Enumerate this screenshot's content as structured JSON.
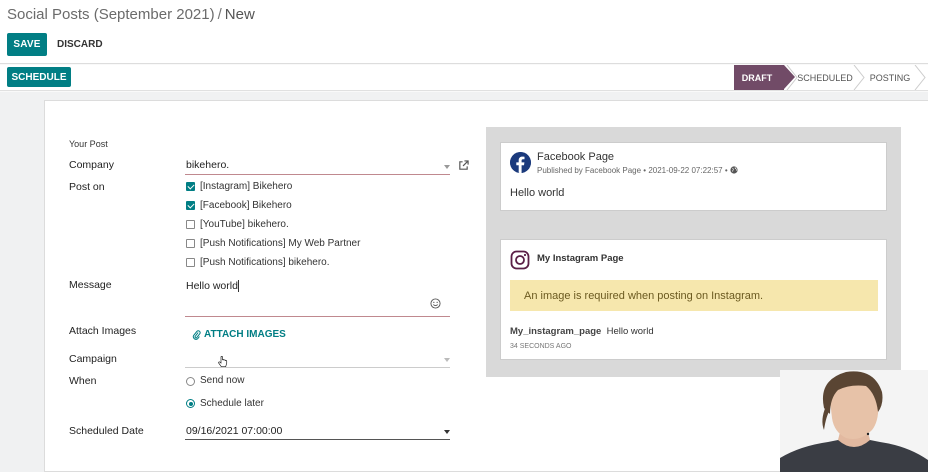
{
  "header": {
    "breadcrumb_parent": "Social Posts (September 2021)",
    "breadcrumb_separator": "/",
    "breadcrumb_current": "New",
    "save_label": "SAVE",
    "discard_label": "DISCARD"
  },
  "statusbar": {
    "schedule_label": "SCHEDULE",
    "stages": [
      {
        "label": "DRAFT",
        "active": true
      },
      {
        "label": "SCHEDULED",
        "active": false
      },
      {
        "label": "POSTING",
        "active": false
      }
    ]
  },
  "form": {
    "section_title": "Your Post",
    "company_label": "Company",
    "company_value": "bikehero.",
    "post_on_label": "Post on",
    "accounts": [
      {
        "label": "[Instagram] Bikehero",
        "checked": true
      },
      {
        "label": "[Facebook] Bikehero",
        "checked": true
      },
      {
        "label": "[YouTube] bikehero.",
        "checked": false
      },
      {
        "label": "[Push Notifications] My Web Partner",
        "checked": false
      },
      {
        "label": "[Push Notifications] bikehero.",
        "checked": false
      }
    ],
    "message_label": "Message",
    "message_value": "Hello world",
    "attach_label": "Attach Images",
    "attach_button": "ATTACH IMAGES",
    "campaign_label": "Campaign",
    "campaign_value": "",
    "when_label": "When",
    "when_options": [
      {
        "label": "Send now",
        "checked": false
      },
      {
        "label": "Schedule later",
        "checked": true
      }
    ],
    "scheduled_date_label": "Scheduled Date",
    "scheduled_date_value": "09/16/2021 07:00:00"
  },
  "preview": {
    "facebook": {
      "page_name": "Facebook Page",
      "meta": "Published by Facebook Page • 2021-09-22 07:22:57 •",
      "message": "Hello world"
    },
    "instagram": {
      "page_name": "My Instagram Page",
      "alert": "An image is required when posting on Instagram.",
      "username": "My_instagram_page",
      "message": "Hello world",
      "time": "34 SECONDS AGO"
    }
  },
  "colors": {
    "primary": "#017e84",
    "stage_active": "#714b67",
    "alert_bg": "#f6e7ad",
    "facebook": "#1b3a7c"
  }
}
